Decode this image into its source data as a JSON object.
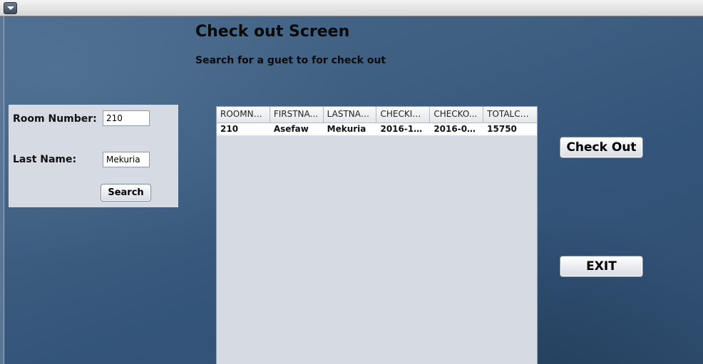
{
  "window": {
    "menu_icon": "chevron-down-icon"
  },
  "heading": "Check out Screen",
  "subheading": "Search for a guet to for check out",
  "search_form": {
    "room_number_label": "Room Number:",
    "room_number_value": "210",
    "last_name_label": "Last Name:",
    "last_name_value": "Mekuria",
    "search_label": "Search"
  },
  "table": {
    "columns": [
      "ROOMNU...",
      "FIRSTNA...",
      "LASTNAME",
      "CHECKIN...",
      "CHECKO...",
      "TOTALCH..."
    ],
    "rows": [
      [
        "210",
        "Asefaw",
        "Mekuria",
        "2016-10-...",
        "2016-09-...",
        "15750"
      ]
    ]
  },
  "actions": {
    "checkout_label": "Check Out",
    "exit_label": "EXIT"
  }
}
